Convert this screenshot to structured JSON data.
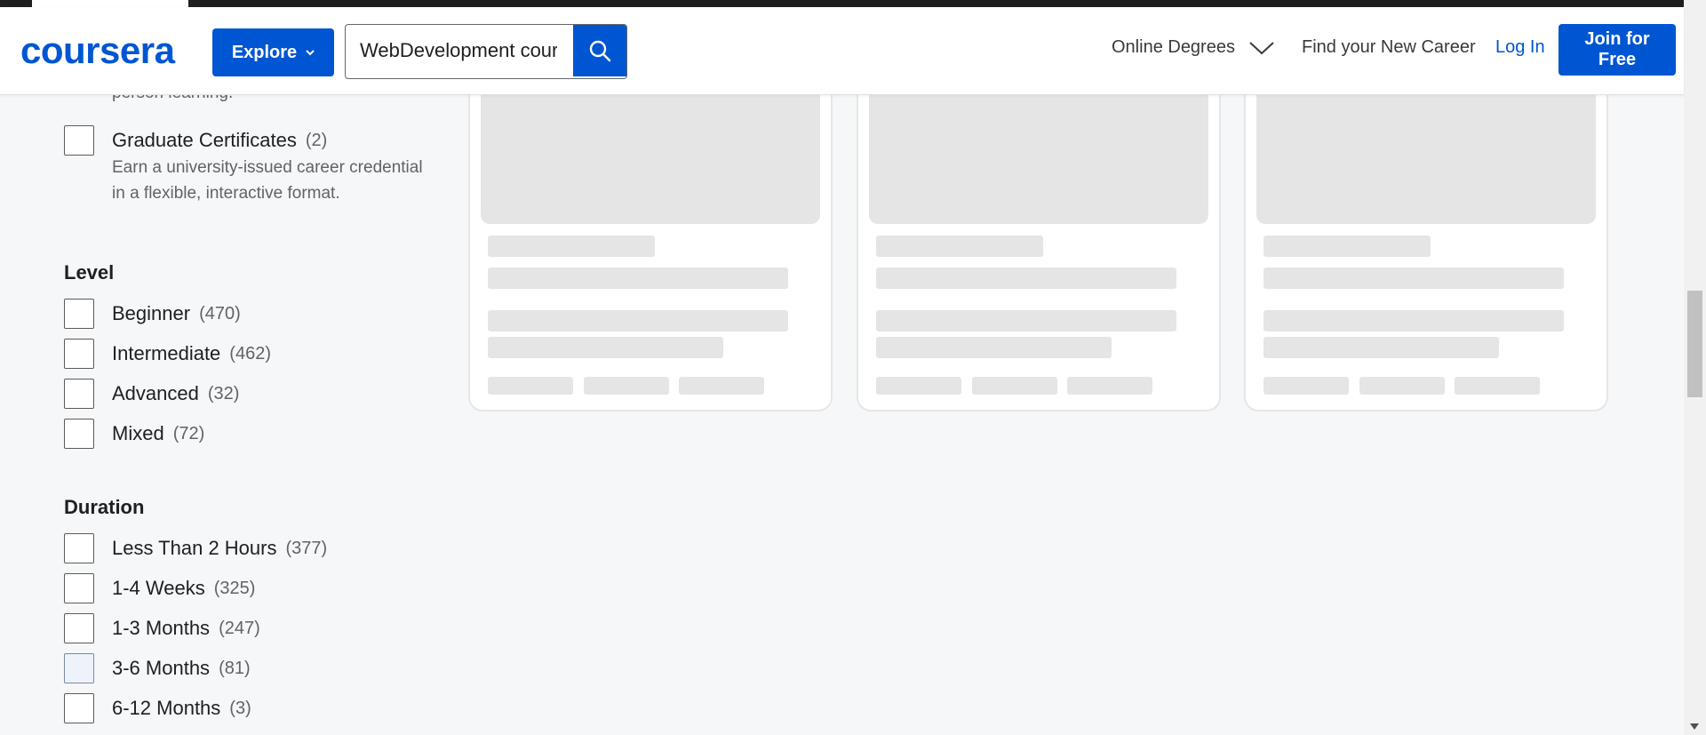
{
  "header": {
    "logo_text": "coursera",
    "explore_label": "Explore",
    "search_value": "WebDevelopment cour",
    "nav_degrees": "Online Degrees",
    "nav_career": "Find your New Career",
    "login_label": "Log In",
    "join_label": "Join for Free"
  },
  "filters": {
    "partial_text": "person learning.",
    "graduate": {
      "label": "Graduate Certificates",
      "count": "(2)",
      "desc_line1": "Earn a university-issued career credential",
      "desc_line2": "in a flexible, interactive format."
    },
    "level": {
      "title": "Level",
      "items": [
        {
          "label": "Beginner",
          "count": "(470)"
        },
        {
          "label": "Intermediate",
          "count": "(462)"
        },
        {
          "label": "Advanced",
          "count": "(32)"
        },
        {
          "label": "Mixed",
          "count": "(72)"
        }
      ]
    },
    "duration": {
      "title": "Duration",
      "items": [
        {
          "label": "Less Than 2 Hours",
          "count": "(377)"
        },
        {
          "label": "1-4 Weeks",
          "count": "(325)"
        },
        {
          "label": "1-3 Months",
          "count": "(247)"
        },
        {
          "label": "3-6 Months",
          "count": "(81)"
        },
        {
          "label": "6-12 Months",
          "count": "(3)"
        }
      ]
    }
  },
  "colors": {
    "brand": "#0056d2",
    "background": "#f5f7f8",
    "skeleton": "#e5e5e5"
  }
}
